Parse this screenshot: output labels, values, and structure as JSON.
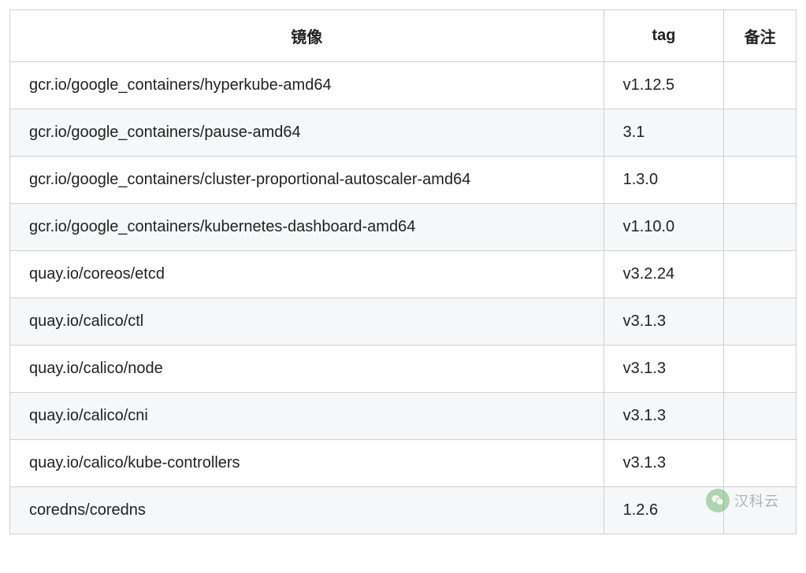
{
  "table": {
    "headers": {
      "image": "镜像",
      "tag": "tag",
      "note": "备注"
    },
    "rows": [
      {
        "image": "gcr.io/google_containers/hyperkube-amd64",
        "tag": "v1.12.5",
        "note": ""
      },
      {
        "image": "gcr.io/google_containers/pause-amd64",
        "tag": "3.1",
        "note": ""
      },
      {
        "image": "gcr.io/google_containers/cluster-proportional-autoscaler-amd64",
        "tag": "1.3.0",
        "note": ""
      },
      {
        "image": "gcr.io/google_containers/kubernetes-dashboard-amd64",
        "tag": "v1.10.0",
        "note": ""
      },
      {
        "image": "quay.io/coreos/etcd",
        "tag": "v3.2.24",
        "note": ""
      },
      {
        "image": "quay.io/calico/ctl",
        "tag": "v3.1.3",
        "note": ""
      },
      {
        "image": "quay.io/calico/node",
        "tag": "v3.1.3",
        "note": ""
      },
      {
        "image": "quay.io/calico/cni",
        "tag": "v3.1.3",
        "note": ""
      },
      {
        "image": "quay.io/calico/kube-controllers",
        "tag": "v3.1.3",
        "note": ""
      },
      {
        "image": "coredns/coredns",
        "tag": "1.2.6",
        "note": ""
      }
    ]
  },
  "watermark": {
    "text": "汉科云"
  }
}
